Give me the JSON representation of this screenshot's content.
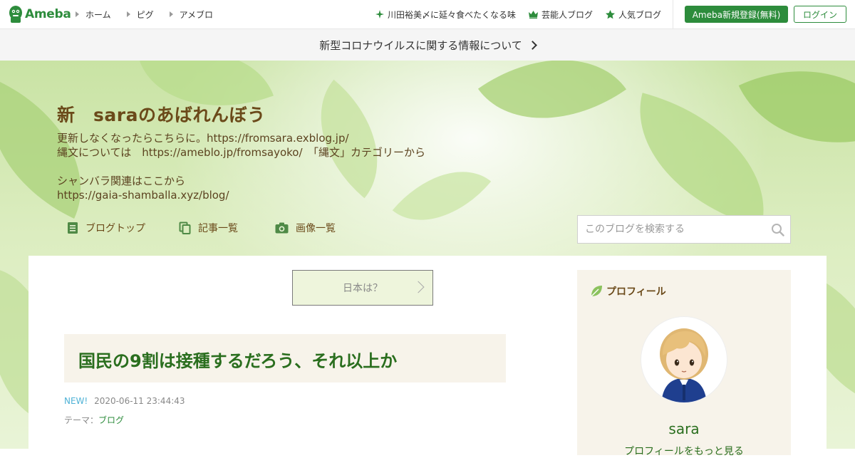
{
  "topbar": {
    "logo_text": "Ameba",
    "nav": [
      {
        "label": "ホーム"
      },
      {
        "label": "ピグ"
      },
      {
        "label": "アメブロ"
      }
    ],
    "links": [
      {
        "label": "川田裕美〆に延々食べたくなる味",
        "icon": "sparkle-icon"
      },
      {
        "label": "芸能人ブログ",
        "icon": "crown-icon"
      },
      {
        "label": "人気ブログ",
        "icon": "star-icon"
      }
    ],
    "register_label": "Ameba新規登録(無料)",
    "login_label": "ログイン"
  },
  "notice": {
    "text": "新型コロナウイルスに関する情報について"
  },
  "blog": {
    "title": "新　saraのあばれんぼう",
    "description": [
      "更新しなくなったらこちらに。https://fromsara.exblog.jp/",
      "縄文については　https://ameblo.jp/fromsayoko/　「縄文」カテゴリーから",
      "",
      "シャンバラ関連はここから",
      "https://gaia-shamballa.xyz/blog/"
    ],
    "nav": [
      {
        "label": "ブログトップ",
        "icon": "document-icon"
      },
      {
        "label": "記事一覧",
        "icon": "copy-icon"
      },
      {
        "label": "画像一覧",
        "icon": "camera-icon"
      }
    ],
    "search_placeholder": "このブログを検索する"
  },
  "entry": {
    "theme_button": "日本は？",
    "title": "国民の9割は接種するだろう、それ以上か",
    "new_label": "NEW!",
    "date": "2020-06-11 23:44:43",
    "theme_prefix": "テーマ：",
    "theme_name": "ブログ"
  },
  "profile": {
    "heading": "プロフィール",
    "name": "sara",
    "subtitle": "プロフィールをもっと見る"
  },
  "colors": {
    "brand_green": "#2d8c3c",
    "title_brown": "#6b4a1a",
    "entry_title_green": "#2a6e1e",
    "new_badge": "#4fb2d6"
  }
}
